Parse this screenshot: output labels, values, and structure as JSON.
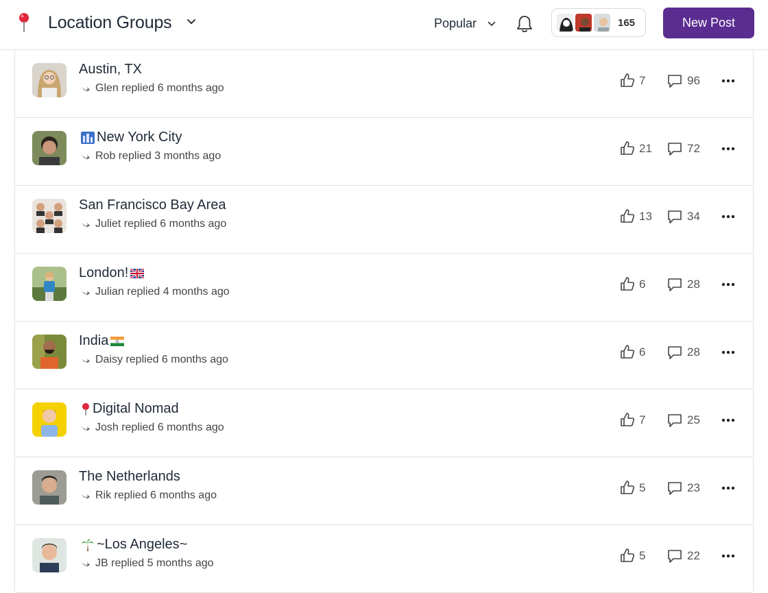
{
  "header": {
    "title": "Location Groups",
    "sort_label": "Popular",
    "member_count": "165",
    "new_post_label": "New Post"
  },
  "colors": {
    "accent": "#5b2d91",
    "pin_red": "#e0283c",
    "text": "#1f2937",
    "border": "#e2e2e2"
  },
  "groups": [
    {
      "title": "Austin, TX",
      "subtitle": "Glen replied 6 months ago",
      "likes": "7",
      "comments": "96"
    },
    {
      "title": "New York City",
      "subtitle": "Rob replied 3 months ago",
      "likes": "21",
      "comments": "72"
    },
    {
      "title": "San Francisco Bay Area",
      "subtitle": "Juliet replied 6 months ago",
      "likes": "13",
      "comments": "34"
    },
    {
      "title": "London!",
      "subtitle": "Julian replied 4 months ago",
      "likes": "6",
      "comments": "28"
    },
    {
      "title": "India",
      "subtitle": "Daisy replied 6 months ago",
      "likes": "6",
      "comments": "28"
    },
    {
      "title": "Digital Nomad",
      "subtitle": "Josh replied 6 months ago",
      "likes": "7",
      "comments": "25"
    },
    {
      "title": "The Netherlands",
      "subtitle": "Rik replied 6 months ago",
      "likes": "5",
      "comments": "23"
    },
    {
      "title": "~Los Angeles~",
      "subtitle": "JB replied 5 months ago",
      "likes": "5",
      "comments": "22"
    }
  ]
}
